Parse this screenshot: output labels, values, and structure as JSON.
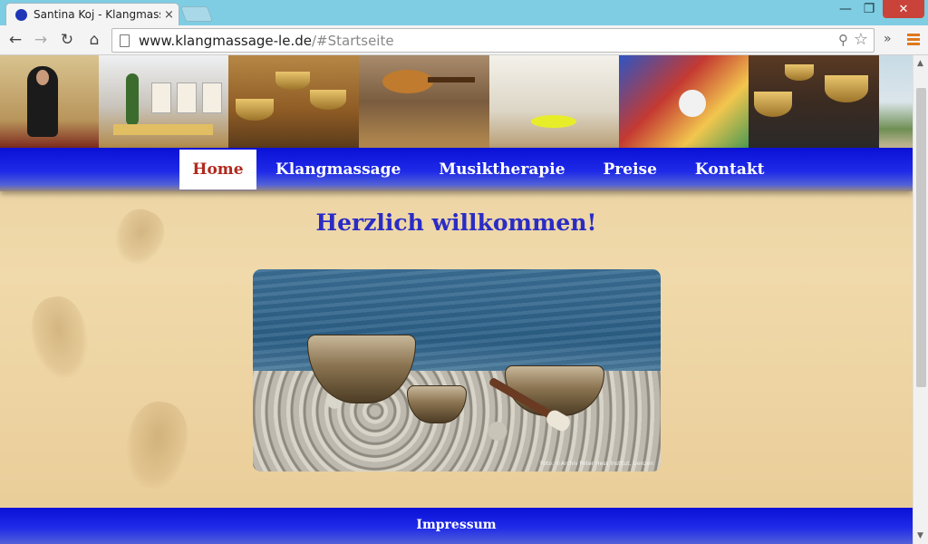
{
  "browser": {
    "tab_title": "Santina Koj - Klangmassage",
    "tab_close": "×",
    "url_host": "www.klangmassage-le.de",
    "url_path": "/#Startseite",
    "ext_label": "»",
    "window_min": "—",
    "window_max": "❐",
    "window_close": "✕",
    "accent_color": "#e0781c"
  },
  "icons": {
    "back": "arrow-left-icon",
    "forward": "arrow-right-icon",
    "reload": "reload-icon",
    "home": "home-icon",
    "zoom": "zoom-icon",
    "star": "star-icon",
    "menu": "hamburger-menu-icon"
  },
  "nav": {
    "items": [
      {
        "label": "Home",
        "active": true
      },
      {
        "label": "Klangmassage",
        "active": false
      },
      {
        "label": "Musiktherapie",
        "active": false
      },
      {
        "label": "Preise",
        "active": false
      },
      {
        "label": "Kontakt",
        "active": false
      }
    ]
  },
  "main": {
    "heading": "Herzlich willkommen!",
    "hero_credit": "Foto: ©Archiv Peter Hess Institut, Uenzen"
  },
  "footer": {
    "link": "Impressum"
  },
  "colors": {
    "nav_blue": "#1f2be8",
    "heading_blue": "#2a2cc5",
    "active_red": "#b1291c",
    "sand": "#f0d9aa"
  }
}
